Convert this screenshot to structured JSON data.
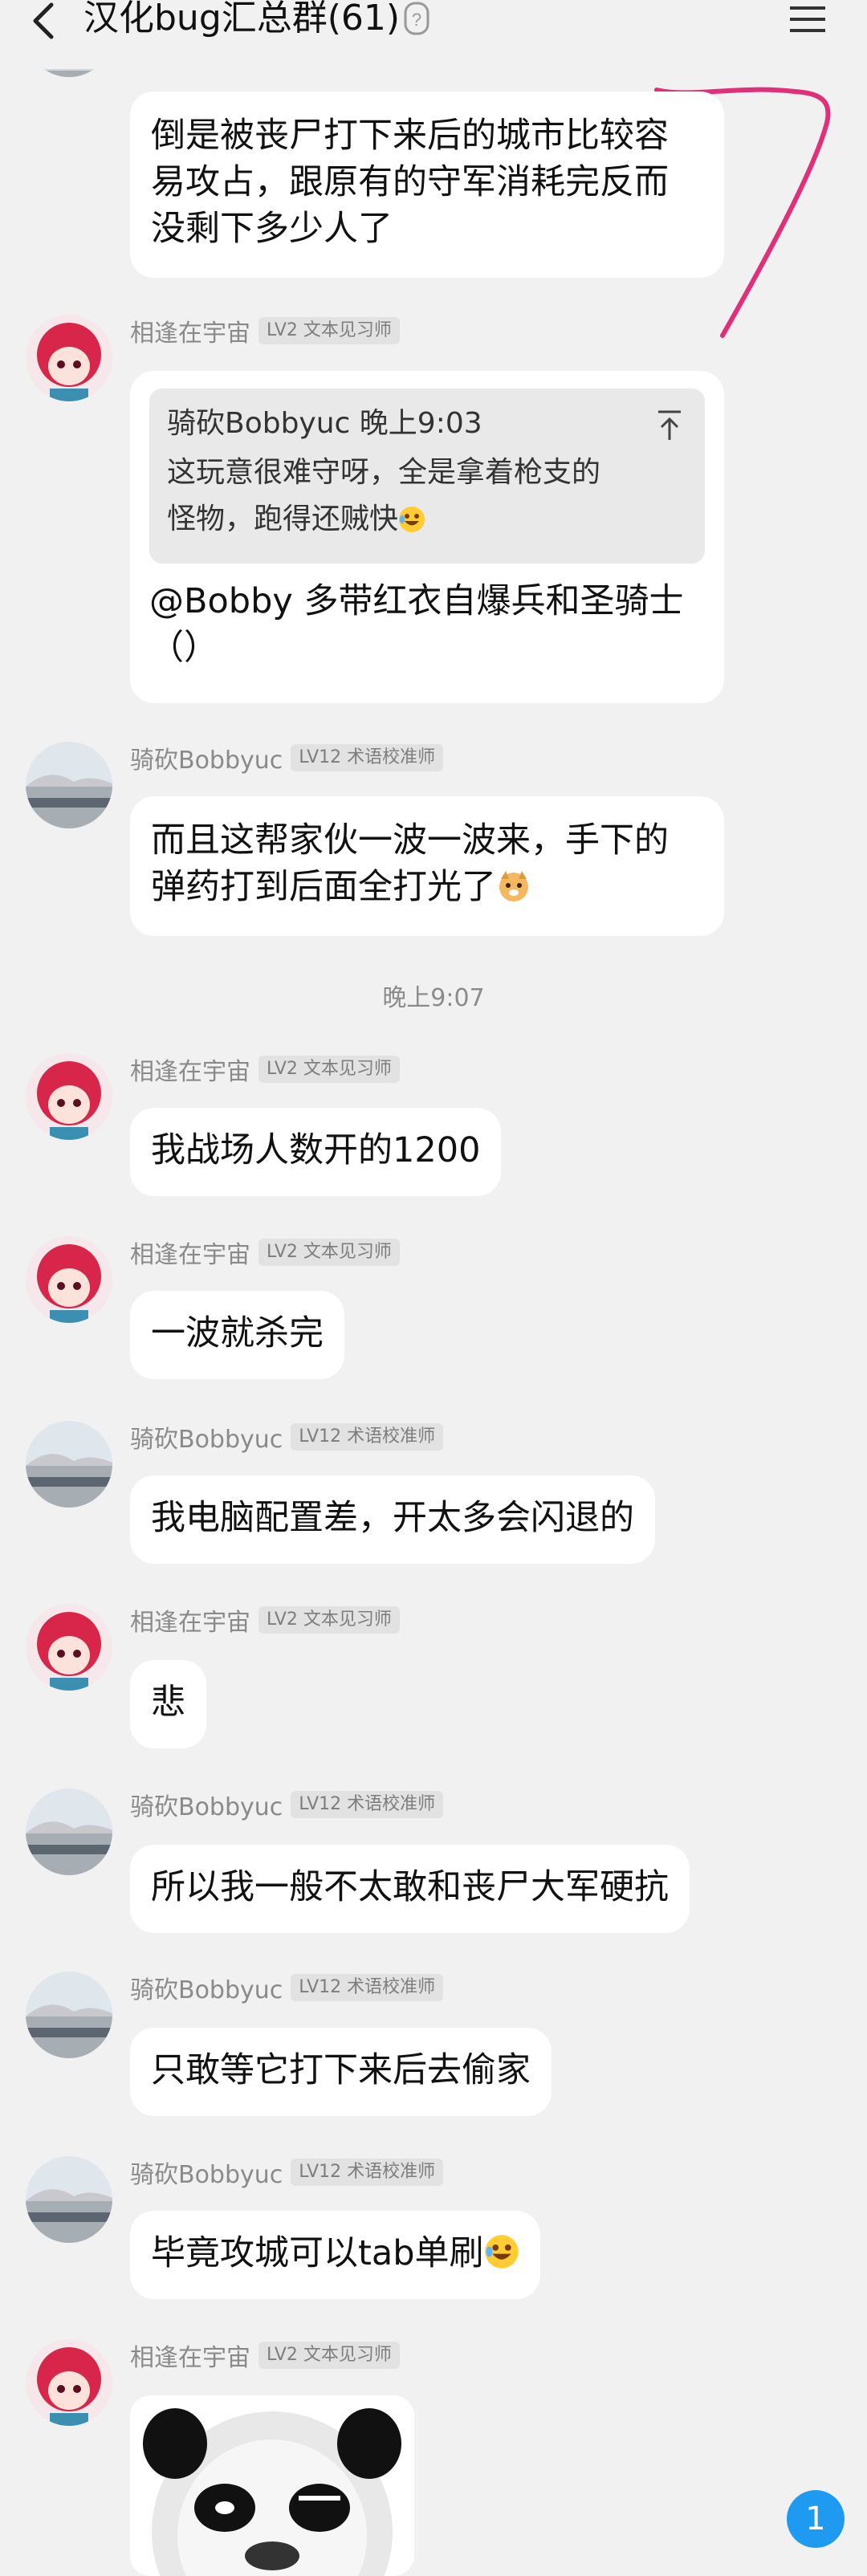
{
  "header": {
    "title": "汉化bug汇总群(61)",
    "icons": [
      "back-icon",
      "help-icon",
      "menu-icon"
    ]
  },
  "users": {
    "a": {
      "name": "相逢在宇宙",
      "badge": "LV2 文本见习师",
      "avatar": "anime-avatar-icon"
    },
    "b": {
      "name": "骑砍Bobbyuc",
      "badge": "LV12 术语校准师",
      "avatar": "landscape-avatar-icon"
    }
  },
  "messages": [
    {
      "sender": "b",
      "text": "倒是被丧尸打下来后的城市比较容\n易攻占，跟原有的守军消耗完反而\n没剩下多少人了"
    },
    {
      "sender": "a",
      "quote": {
        "author_time": "骑砍Bobbyuc 晚上9:03",
        "text": "这玩意很难守呀，全是拿着枪支的\n怪物，跑得还贼快"
      },
      "text": "@Bobby 多带红衣自爆兵和圣骑士\n（）"
    },
    {
      "sender": "b",
      "text": "而且这帮家伙一波一波来，手下的\n弹药打到后面全打光了"
    },
    {
      "sender": "a",
      "text": "我战场人数开的1200"
    },
    {
      "sender": "a",
      "text": "一波就杀完"
    },
    {
      "sender": "b",
      "text": "我电脑配置差，开太多会闪退的"
    },
    {
      "sender": "a",
      "text": "悲"
    },
    {
      "sender": "b",
      "text": "所以我一般不太敢和丧尸大军硬抗"
    },
    {
      "sender": "b",
      "text": "只敢等它打下来后去偷家"
    },
    {
      "sender": "b",
      "text": "毕竟攻城可以tab单刷"
    },
    {
      "sender": "a",
      "sticker": "panda-meme-sticker"
    }
  ],
  "time_separator": "晚上9:07",
  "unread_count": "1",
  "colors": {
    "background": "#f1f1f1",
    "bubble": "#ffffff",
    "badge": "#1e9bf0",
    "annotation": "#e0307a"
  }
}
